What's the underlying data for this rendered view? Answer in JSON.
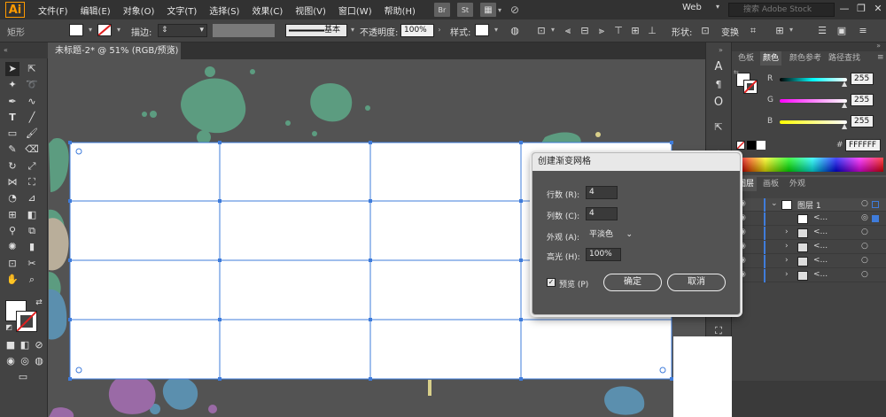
{
  "app": {
    "logo": "Ai",
    "workspace": "Web",
    "search_placeholder": "搜索 Adobe Stock"
  },
  "menu": [
    "文件(F)",
    "编辑(E)",
    "对象(O)",
    "文字(T)",
    "选择(S)",
    "效果(C)",
    "视图(V)",
    "窗口(W)",
    "帮助(H)"
  ],
  "menu_buttons": {
    "br": "Br",
    "st": "St"
  },
  "controlbar": {
    "shape_label": "矩形",
    "stroke_label": "描边:",
    "stroke_style": "基本",
    "opacity_label": "不透明度:",
    "opacity_value": "100%",
    "style_label": "样式:",
    "shape_label2": "形状:",
    "transform_label": "变换"
  },
  "document_tab": {
    "title": "未标题-2* @ 51% (RGB/预览)",
    "close": "×"
  },
  "color_panel": {
    "tabs": [
      "色板",
      "颜色",
      "颜色参考",
      "路径查找"
    ],
    "active_tab": "颜色",
    "channels": [
      {
        "label": "R",
        "value": "255",
        "gradient": "linear-gradient(to right,#000,#ff0000)"
      },
      {
        "label": "G",
        "value": "255",
        "gradient": "linear-gradient(to right,#00ffff,#ffffff)"
      },
      {
        "label": "B",
        "value": "255",
        "gradient": "linear-gradient(to right,#ffff00,#ff00ff)"
      }
    ],
    "hex_prefix": "#",
    "hex_value": "FFFFFF"
  },
  "layers_panel": {
    "tabs": [
      "图层",
      "画板",
      "外观"
    ],
    "active_tab": "图层",
    "layer_name": "图层 1",
    "sublayers": [
      "<...",
      "<...",
      "<...",
      "<...",
      "<..."
    ]
  },
  "dialog": {
    "title": "创建渐变网格",
    "rows_label": "行数 (R):",
    "rows_value": "4",
    "cols_label": "列数 (C):",
    "cols_value": "4",
    "appearance_label": "外观 (A):",
    "appearance_value": "平淡色",
    "highlight_label": "高光 (H):",
    "highlight_value": "100%",
    "preview_label": "预览 (P)",
    "ok_label": "确定",
    "cancel_label": "取消"
  },
  "colors": {
    "accent_mesh": "#3f7cdb",
    "splash_green": "#5c9c80",
    "splash_purple": "#9a6aa6",
    "splash_blue": "#5b8fae",
    "splash_beige": "#b9ae9a"
  }
}
